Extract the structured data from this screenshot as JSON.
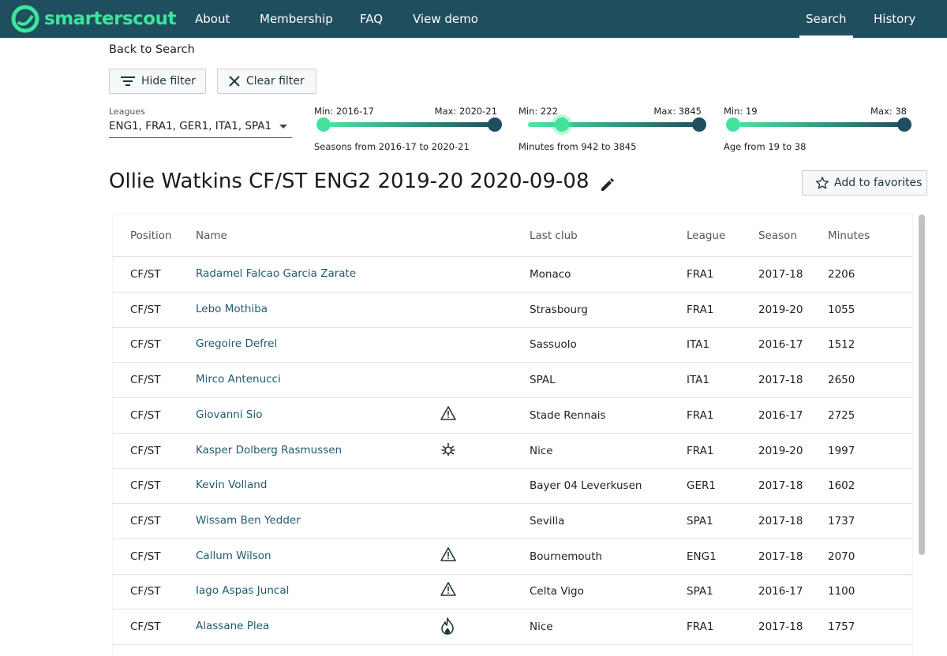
{
  "nav": {
    "brand": "smarterscout",
    "items": [
      "About",
      "Membership",
      "FAQ",
      "View demo"
    ],
    "right_items": [
      "Search",
      "History"
    ],
    "active": "Search",
    "colors": {
      "bar": "#1f4e5f",
      "accent": "#3de59a"
    }
  },
  "back_label": "Back to Search",
  "buttons": {
    "hide_filter": "Hide filter",
    "clear_filter": "Clear filter",
    "add_favorites": "Add to favorites"
  },
  "filters": {
    "leagues_label": "Leagues",
    "leagues_value": "ENG1, FRA1, GER1, ITA1, SPA1",
    "seasons": {
      "min_label": "Min: 2016-17",
      "max_label": "Max: 2020-21",
      "desc": "Seasons from 2016-17 to 2020-21",
      "low": 0,
      "high": 1
    },
    "minutes": {
      "min_label": "Min: 222",
      "max_label": "Max: 3845",
      "desc": "Minutes from 942 to 3845",
      "low": 0.2,
      "high": 1
    },
    "age": {
      "min_label": "Min: 19",
      "max_label": "Max: 38",
      "desc": "Age from 19 to 38",
      "low": 0,
      "high": 1
    }
  },
  "title": "Ollie Watkins CF/ST ENG2 2019-20 2020-09-08",
  "table": {
    "headers": {
      "position": "Position",
      "name": "Name",
      "last_club": "Last club",
      "league": "League",
      "season": "Season",
      "minutes": "Minutes"
    },
    "rows": [
      {
        "position": "CF/ST",
        "name": "Radamel Falcao Garcia Zarate",
        "flag": "",
        "club": "Monaco",
        "league": "FRA1",
        "season": "2017-18",
        "minutes": "2206"
      },
      {
        "position": "CF/ST",
        "name": "Lebo Mothiba",
        "flag": "",
        "club": "Strasbourg",
        "league": "FRA1",
        "season": "2019-20",
        "minutes": "1055"
      },
      {
        "position": "CF/ST",
        "name": "Gregoire Defrel",
        "flag": "",
        "club": "Sassuolo",
        "league": "ITA1",
        "season": "2016-17",
        "minutes": "1512"
      },
      {
        "position": "CF/ST",
        "name": "Mirco Antenucci",
        "flag": "",
        "club": "SPAL",
        "league": "ITA1",
        "season": "2017-18",
        "minutes": "2650"
      },
      {
        "position": "CF/ST",
        "name": "Giovanni Sio",
        "flag": "warning-icon",
        "club": "Stade Rennais",
        "league": "FRA1",
        "season": "2016-17",
        "minutes": "2725"
      },
      {
        "position": "CF/ST",
        "name": "Kasper Dolberg Rasmussen",
        "flag": "virus-icon",
        "club": "Nice",
        "league": "FRA1",
        "season": "2019-20",
        "minutes": "1997"
      },
      {
        "position": "CF/ST",
        "name": "Kevin Volland",
        "flag": "",
        "club": "Bayer 04 Leverkusen",
        "league": "GER1",
        "season": "2017-18",
        "minutes": "1602"
      },
      {
        "position": "CF/ST",
        "name": "Wissam Ben Yedder",
        "flag": "",
        "club": "Sevilla",
        "league": "SPA1",
        "season": "2017-18",
        "minutes": "1737"
      },
      {
        "position": "CF/ST",
        "name": "Callum Wilson",
        "flag": "warning-icon",
        "club": "Bournemouth",
        "league": "ENG1",
        "season": "2017-18",
        "minutes": "2070"
      },
      {
        "position": "CF/ST",
        "name": "Iago Aspas Juncal",
        "flag": "warning-icon",
        "club": "Celta Vigo",
        "league": "SPA1",
        "season": "2016-17",
        "minutes": "1100"
      },
      {
        "position": "CF/ST",
        "name": "Alassane Plea",
        "flag": "flame-icon",
        "club": "Nice",
        "league": "FRA1",
        "season": "2017-18",
        "minutes": "1757"
      }
    ]
  }
}
